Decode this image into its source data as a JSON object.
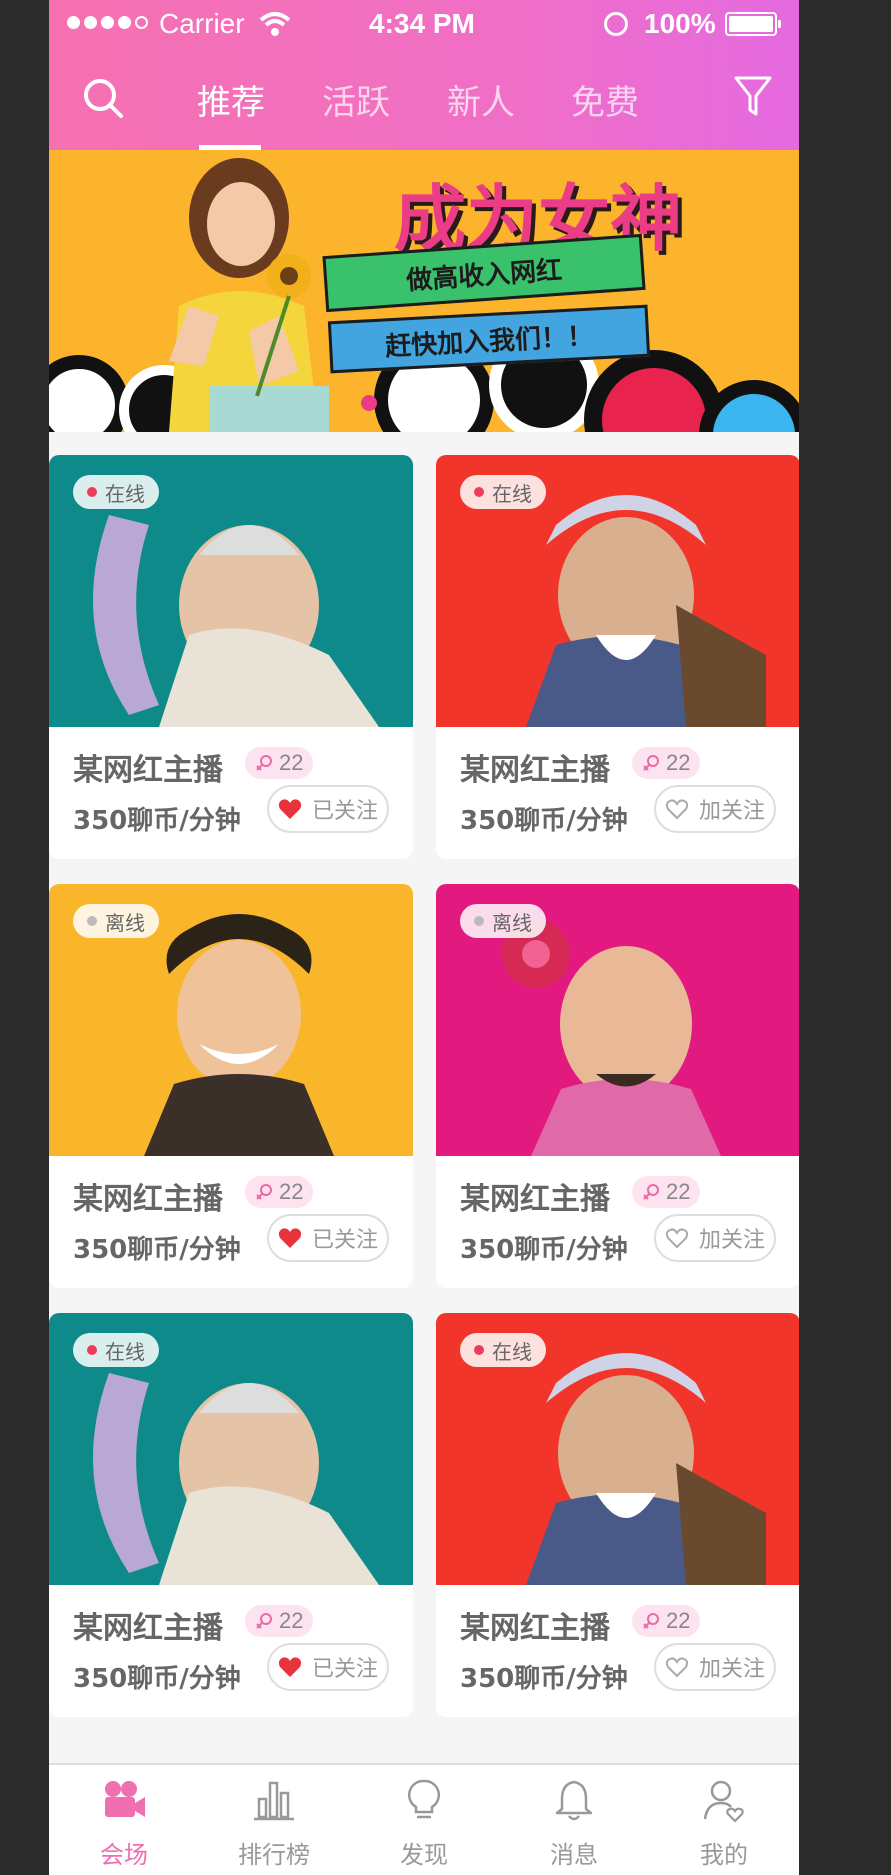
{
  "status_bar": {
    "carrier": "Carrier",
    "time": "4:34 PM",
    "battery": "100%"
  },
  "nav": {
    "tabs": [
      {
        "label": "推荐",
        "active": true
      },
      {
        "label": "活跃",
        "active": false
      },
      {
        "label": "新人",
        "active": false
      },
      {
        "label": "免费",
        "active": false
      }
    ],
    "icons": [
      "search-icon",
      "filter-icon"
    ]
  },
  "banner": {
    "title": "成为女神",
    "line1": "做高收入网红",
    "line2": "赶快加入我们！！"
  },
  "cards": [
    {
      "status": "在线",
      "online": true,
      "name": "某网红主播",
      "fans": "22",
      "price": "350聊币/分钟",
      "follow": "已关注",
      "followed": true,
      "theme": "teal"
    },
    {
      "status": "在线",
      "online": true,
      "name": "某网红主播",
      "fans": "22",
      "price": "350聊币/分钟",
      "follow": "加关注",
      "followed": false,
      "theme": "red"
    },
    {
      "status": "离线",
      "online": false,
      "name": "某网红主播",
      "fans": "22",
      "price": "350聊币/分钟",
      "follow": "已关注",
      "followed": true,
      "theme": "yellow"
    },
    {
      "status": "离线",
      "online": false,
      "name": "某网红主播",
      "fans": "22",
      "price": "350聊币/分钟",
      "follow": "加关注",
      "followed": false,
      "theme": "magenta"
    },
    {
      "status": "在线",
      "online": true,
      "name": "某网红主播",
      "fans": "22",
      "price": "350聊币/分钟",
      "follow": "已关注",
      "followed": true,
      "theme": "teal"
    },
    {
      "status": "在线",
      "online": true,
      "name": "某网红主播",
      "fans": "22",
      "price": "350聊币/分钟",
      "follow": "加关注",
      "followed": false,
      "theme": "red"
    }
  ],
  "tabbar": [
    {
      "label": "会场",
      "icon": "camera-icon",
      "active": true
    },
    {
      "label": "排行榜",
      "icon": "ranking-icon",
      "active": false
    },
    {
      "label": "发现",
      "icon": "bulb-icon",
      "active": false
    },
    {
      "label": "消息",
      "icon": "bell-icon",
      "active": false
    },
    {
      "label": "我的",
      "icon": "profile-icon",
      "active": false
    }
  ],
  "colors": {
    "header_start": "#f671b0",
    "header_end": "#e56ae0",
    "page_bg": "#f5f5f5",
    "text_gray": "#666666",
    "divider": "#dedede",
    "tabbar_bg": "#ffffff",
    "accent": "#f06fb0",
    "online_dot": "#ee3b5b",
    "offline_dot": "#bbbbbb",
    "heart": "#e8323c",
    "theme_teal": "#0f8a8a",
    "theme_red": "#f2352a",
    "theme_yellow": "#f9b62a",
    "theme_magenta": "#e2197f"
  }
}
